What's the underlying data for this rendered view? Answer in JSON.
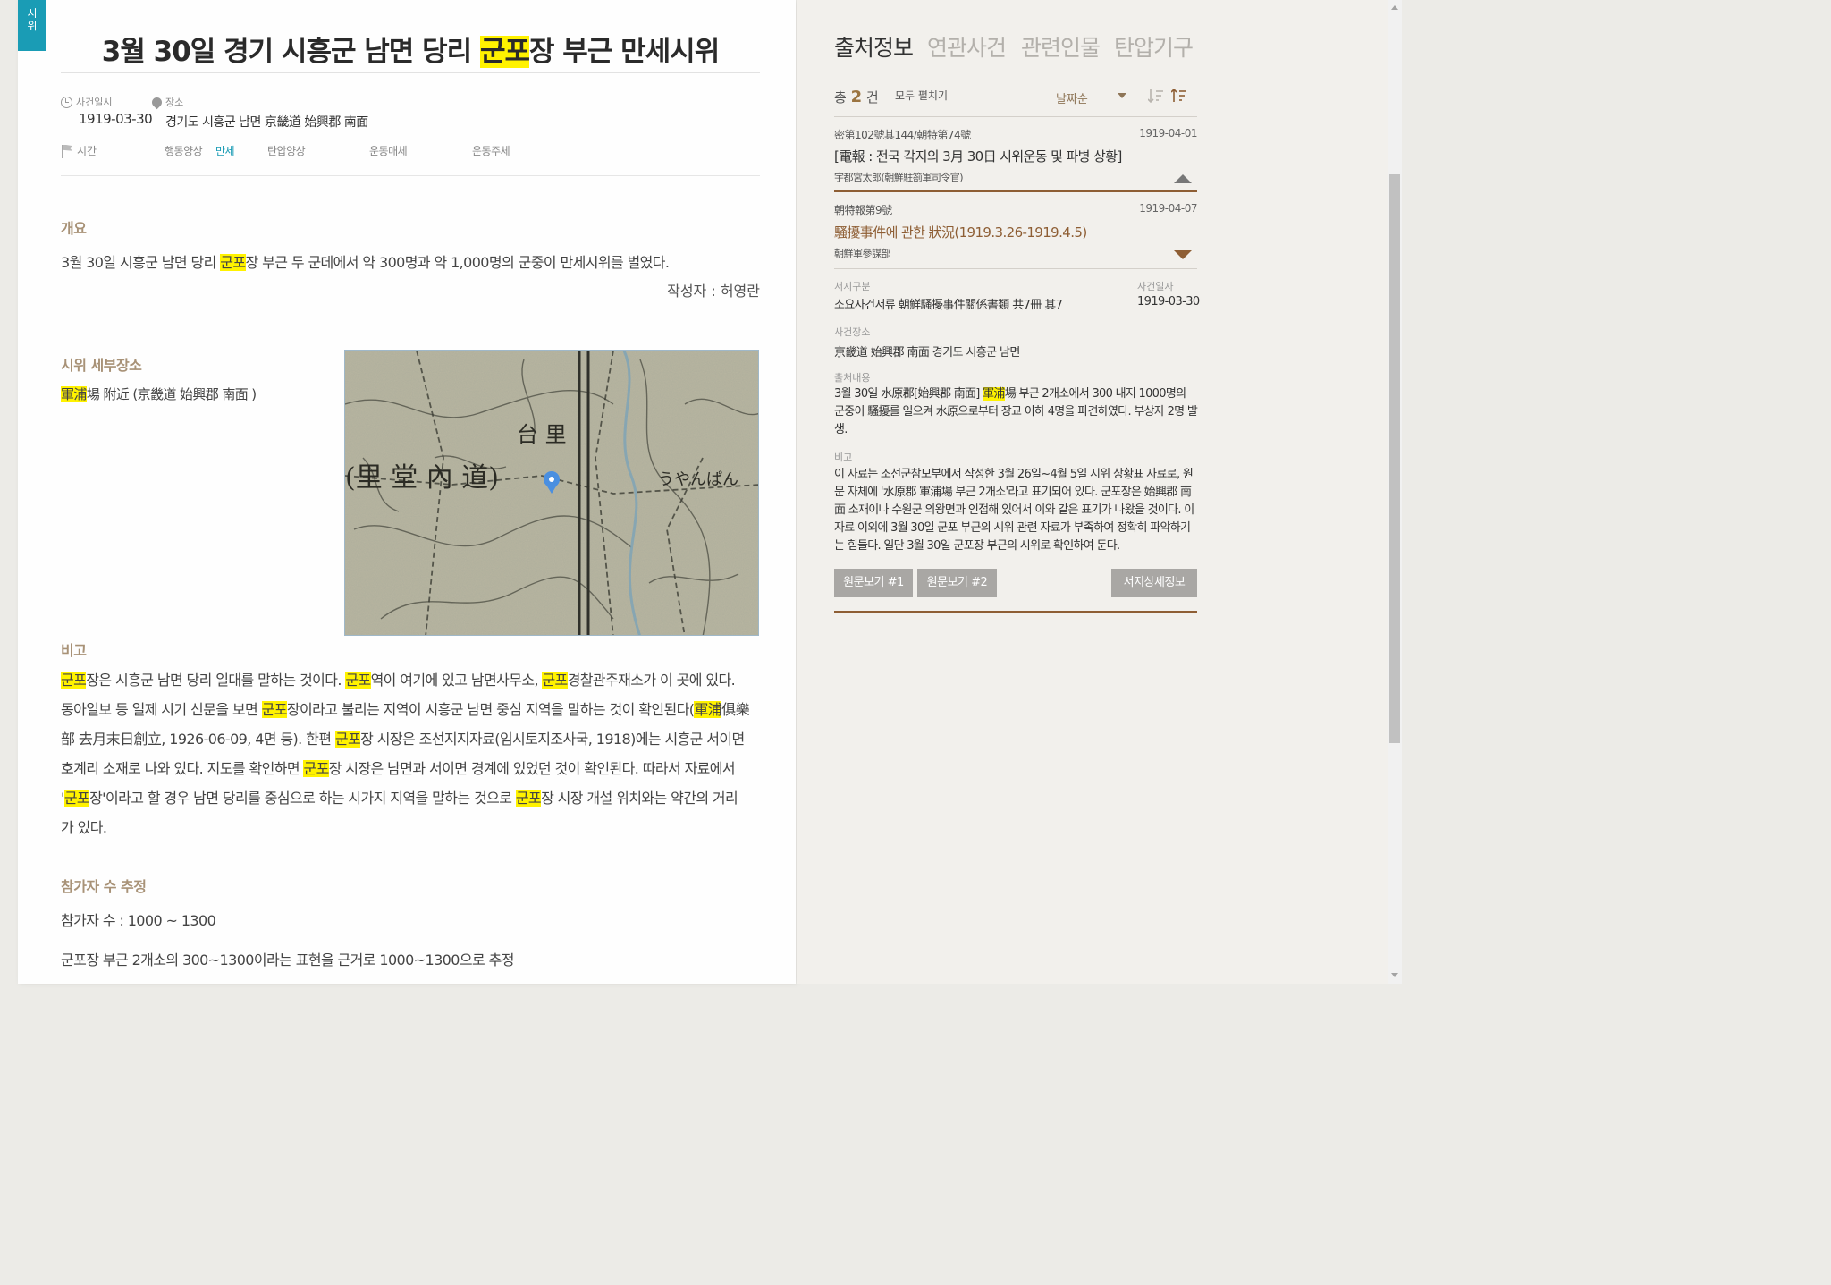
{
  "event": {
    "tag_chars": [
      "시",
      "위"
    ],
    "title_pre": "3월 30일 경기 시흥군 남면 당리 ",
    "title_hl": "군포",
    "title_post": "장 부근 만세시위",
    "date_label": "사건일시",
    "date_value": "1919-03-30",
    "place_label": "장소",
    "place_value": "경기도 시흥군 남면 京畿道 始興郡 南面",
    "categories": {
      "time_label": "시간",
      "action_label": "행동양상",
      "action_value": "만세",
      "oppression_label": "탄압양상",
      "medium_label": "운동매체",
      "subject_label": "운동주체"
    }
  },
  "overview": {
    "heading": "개요",
    "text_pre": "3월 30일 시흥군 남면 당리 ",
    "text_hl": "군포",
    "text_post": "장 부근 두 군데에서 약 300명과 약 1,000명의 군중이 만세시위를 벌였다.",
    "author": "작성자 : 허영란"
  },
  "place_detail": {
    "heading": "시위 세부장소",
    "text_hl": "軍浦",
    "text_post": "場 附近 (京畿道 始興郡 南面 )"
  },
  "remarks": {
    "heading": "비고",
    "segments": [
      {
        "hl": "군포"
      },
      {
        "t": "장은 시흥군 남면 당리 일대를 말하는 것이다. "
      },
      {
        "hl": "군포"
      },
      {
        "t": "역이 여기에 있고 남면사무소, "
      },
      {
        "hl": "군포"
      },
      {
        "t": "경찰관주재소가 이 곳에 있다. 동아일보 등 일제 시기 신문을 보면 "
      },
      {
        "hl": "군포"
      },
      {
        "t": "장이라고 불리는 지역이 시흥군 남면 중심 지역을 말하는 것이 확인된다("
      },
      {
        "hl": "軍浦"
      },
      {
        "t": "俱樂部 去月末日創立, 1926-06-09, 4면 등). 한편 "
      },
      {
        "hl": "군포"
      },
      {
        "t": "장 시장은 조선지지자료(임시토지조사국, 1918)에는 시흥군 서이면 호계리 소재로 나와 있다. 지도를 확인하면 "
      },
      {
        "hl": "군포"
      },
      {
        "t": "장 시장은 남면과 서이면 경계에 있었던 것이 확인된다. 따라서 자료에서 '"
      },
      {
        "hl": "군포"
      },
      {
        "t": "장'이라고 할 경우 남면 당리를 중심으로 하는 시가지 지역을 말하는 것으로 "
      },
      {
        "hl": "군포"
      },
      {
        "t": "장 시장 개설 위치와는 약간의 거리가 있다."
      }
    ]
  },
  "participants": {
    "heading": "참가자 수 추정",
    "count": "참가자 수 : 1000 ~ 1300",
    "basis": "군포장 부근 2개소의 300~1300이라는 표현을 근거로 1000~1300으로 추정"
  },
  "map": {
    "labels": [
      "(里 堂 內 道)",
      "台 里",
      "うやんぱん"
    ],
    "marker_color": "#4a8fe0"
  },
  "right_panel": {
    "tabs": [
      "출처정보",
      "연관사건",
      "관련인물",
      "탄압기구"
    ],
    "count_prefix": "총",
    "count": "2",
    "count_suffix": "건",
    "expand_all": "모두 펼치기",
    "sort_selected": "날짜순",
    "sources": [
      {
        "code": "密第102號其144/朝特第74號",
        "date": "1919-04-01",
        "title": "[電報 : 전국 각지의 3月 30日 시위운동 및 파병 상황]",
        "author": "宇都宮太郎(朝鮮駐箚軍司令官)",
        "expanded": false
      },
      {
        "code": "朝特報第9號",
        "date": "1919-04-07",
        "title": "騷擾事件에 관한 狀況(1919.3.26-1919.4.5)",
        "author": "朝鮮軍參謀部",
        "expanded": true
      }
    ],
    "detail": {
      "doc_type_label": "서지구분",
      "doc_type_value": "소요사건서류 朝鮮騷擾事件關係書類 共7冊 其7",
      "event_date_label": "사건일자",
      "event_date_value": "1919-03-30",
      "event_place_label": "사건장소",
      "event_place_value": "京畿道 始興郡 南面 경기도 시흥군 남면",
      "content_label": "출처내용",
      "content_pre": "3월 30일 水原郡[始興郡 南面] ",
      "content_hl": "軍浦",
      "content_post": "場 부근 2개소에서 300 내지 1000명의 군중이 騷擾를 일으켜 水原으로부터 장교 이하 4명을 파견하였다. 부상자 2명 발생.",
      "note_label": "비고",
      "note_text": "이 자료는 조선군참모부에서 작성한 3월 26일~4월 5일 시위 상황표 자료로, 원문 자체에 '水原郡 軍浦場 부근 2개소'라고 표기되어 있다. 군포장은 始興郡 南面 소재이나 수원군 의왕면과 인접해 있어서 이와 같은 표기가 나왔을 것이다. 이 자료 이외에 3월 30일 군포 부근의 시위 관련 자료가 부족하여 정확히 파악하기는 힘들다. 일단 3월 30일 군포장 부근의 시위로 확인하여 둔다."
    },
    "buttons": {
      "view1": "원문보기 #1",
      "view2": "원문보기 #2",
      "biblio": "서지상세정보"
    }
  },
  "colors": {
    "highlight": "#fff200",
    "accent_teal": "#1a9cb5",
    "accent_brown": "#8e5e34",
    "section_heading": "#a89277"
  }
}
